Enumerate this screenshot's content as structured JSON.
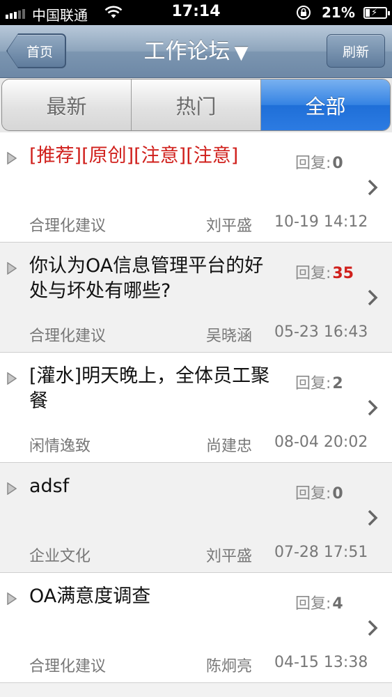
{
  "status_bar": {
    "carrier": "中国联通",
    "time": "17:14",
    "battery": "21%"
  },
  "nav": {
    "back_label": "首页",
    "title": "工作论坛",
    "title_caret": "▼",
    "refresh_label": "刷新"
  },
  "tabs": [
    {
      "label": "最新",
      "active": false
    },
    {
      "label": "热门",
      "active": false
    },
    {
      "label": "全部",
      "active": true
    }
  ],
  "reply_label": "回复:",
  "posts": [
    {
      "title": "[推荐][原创][注意][注意]",
      "title_color": "#d0201c",
      "replies": "0",
      "category": "合理化建议",
      "author": "刘平盛",
      "time": "10-19 14:12"
    },
    {
      "title": "你认为OA信息管理平台的好处与坏处有哪些?",
      "title_color": "#111111",
      "replies": "35",
      "replies_hot": true,
      "category": "合理化建议",
      "author": "吴晓涵",
      "time": "05-23 16:43"
    },
    {
      "title": "[灌水]明天晚上，全体员工聚餐",
      "title_color": "#111111",
      "replies": "2",
      "category": "闲情逸致",
      "author": "尚建忠",
      "time": "08-04 20:02"
    },
    {
      "title": "adsf",
      "title_color": "#111111",
      "replies": "0",
      "category": "企业文化",
      "author": "刘平盛",
      "time": "07-28 17:51"
    },
    {
      "title": "OA满意度调查",
      "title_color": "#111111",
      "replies": "4",
      "category": "合理化建议",
      "author": "陈炯亮",
      "time": "04-15 13:38"
    }
  ],
  "colors": {
    "accent": "#2c7be2",
    "hot": "#d0201c"
  }
}
